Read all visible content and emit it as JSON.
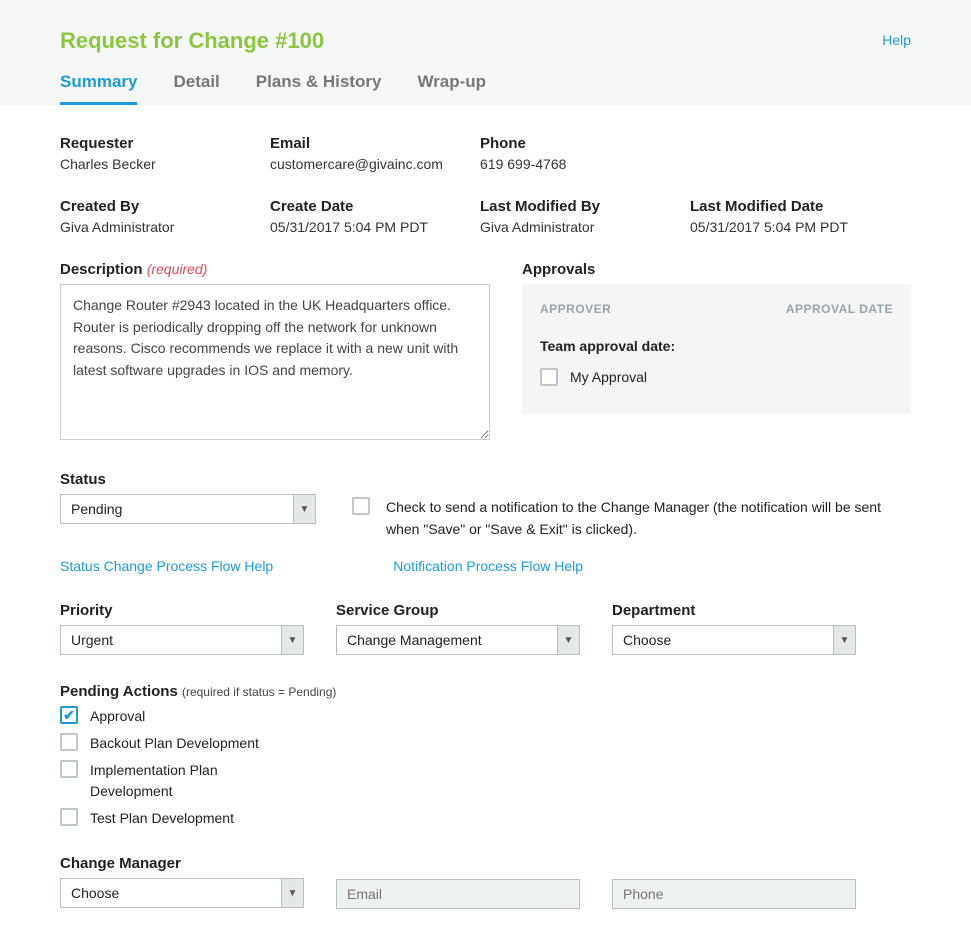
{
  "header": {
    "title": "Request for Change #100",
    "help": "Help"
  },
  "tabs": [
    "Summary",
    "Detail",
    "Plans & History",
    "Wrap-up"
  ],
  "info": {
    "requester_label": "Requester",
    "requester_value": "Charles Becker",
    "email_label": "Email",
    "email_value": "customercare@givainc.com",
    "phone_label": "Phone",
    "phone_value": "619 699-4768",
    "createdby_label": "Created By",
    "createdby_value": "Giva Administrator",
    "createdate_label": "Create Date",
    "createdate_value": "05/31/2017 5:04 PM PDT",
    "lastmodby_label": "Last Modified By",
    "lastmodby_value": "Giva Administrator",
    "lastmoddate_label": "Last Modified Date",
    "lastmoddate_value": "05/31/2017 5:04 PM PDT"
  },
  "description": {
    "label": "Description",
    "required": "(required)",
    "value": "Change Router #2943 located in the UK Headquarters office. Router is periodically dropping off the network for unknown reasons. Cisco recommends we replace it with a new unit with latest software upgrades in IOS and memory."
  },
  "approvals": {
    "label": "Approvals",
    "approver_col": "APPROVER",
    "date_col": "APPROVAL DATE",
    "team_label": "Team approval date:",
    "my_approval": "My Approval"
  },
  "status": {
    "label": "Status",
    "value": "Pending",
    "notify_text": "Check to send a notification to the Change Manager (the notification will be sent when \"Save\" or \"Save & Exit\" is clicked).",
    "status_help": "Status Change Process Flow Help",
    "notify_help": "Notification Process Flow Help"
  },
  "selects": {
    "priority_label": "Priority",
    "priority_value": "Urgent",
    "servicegroup_label": "Service Group",
    "servicegroup_value": "Change Management",
    "department_label": "Department",
    "department_value": "Choose"
  },
  "pending": {
    "label": "Pending Actions",
    "hint": "(required if status = Pending)",
    "items": [
      {
        "label": "Approval",
        "checked": true
      },
      {
        "label": "Backout Plan Development",
        "checked": false
      },
      {
        "label": "Implementation Plan Development",
        "checked": false
      },
      {
        "label": "Test Plan Development",
        "checked": false
      }
    ]
  },
  "change_manager": {
    "label": "Change Manager",
    "value": "Choose",
    "email_placeholder": "Email",
    "phone_placeholder": "Phone"
  }
}
